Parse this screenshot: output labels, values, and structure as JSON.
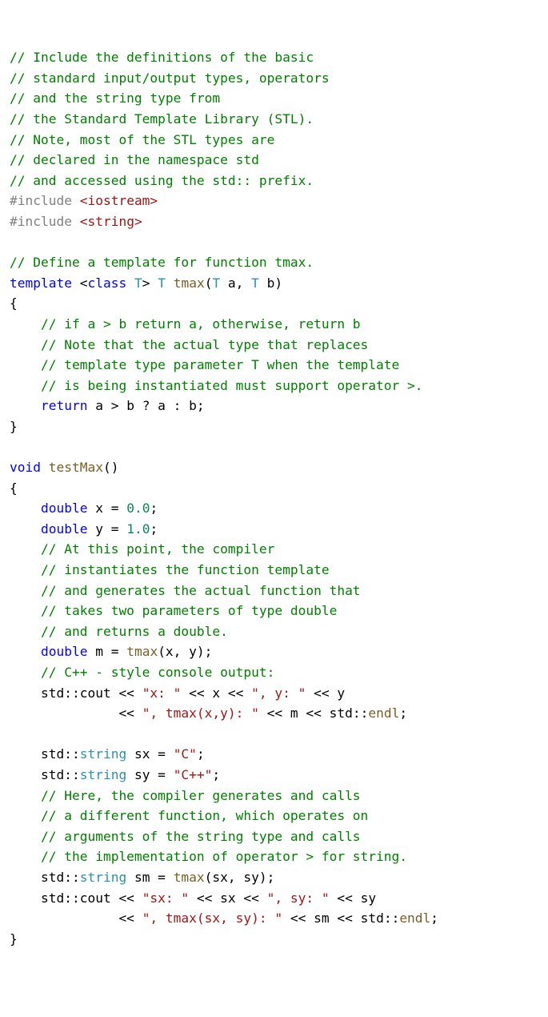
{
  "code": {
    "cm1": "// Include the definitions of the basic",
    "cm2": "// standard input/output types, operators",
    "cm3": "// and the string type from",
    "cm4": "// the Standard Template Library (STL).",
    "cm5": "// Note, most of the STL types are",
    "cm6": "// declared in the namespace std",
    "cm7": "// and accessed using the std:: prefix.",
    "pre_include1": "#include",
    "inc_iostream": "<iostream>",
    "pre_include2": "#include",
    "inc_string": "<string>",
    "cm8": "// Define a template for function tmax.",
    "kw_template": "template",
    "kw_class": "class",
    "tp_T1": "T",
    "tp_T2": "T",
    "fn_tmax_decl": "tmax",
    "tp_T3": "T",
    "tp_T4": "T",
    "cm9": "// if a > b return a, otherwise, return b",
    "cm10": "// Note that the actual type that replaces",
    "cm11": "// template type parameter T when the template",
    "cm12": "// is being instantiated must support operator >.",
    "kw_return1": "return",
    "kw_void": "void",
    "fn_testMax": "testMax",
    "kw_double1": "double",
    "num_0": "0.0",
    "kw_double2": "double",
    "num_1": "1.0",
    "cm13": "// At this point, the compiler",
    "cm14": "// instantiates the function template",
    "cm15": "// and generates the actual function that",
    "cm16": "// takes two parameters of type double",
    "cm17": "// and returns a double.",
    "kw_double3": "double",
    "fn_tmax_call1": "tmax",
    "cm18": "// C++ - style console output:",
    "str_x": "\"x: \"",
    "str_y": "\", y: \"",
    "str_tmaxxy": "\", tmax(x,y): \"",
    "fn_endl1": "endl",
    "ty_string1": "string",
    "str_C": "\"C\"",
    "ty_string2": "string",
    "str_Cpp": "\"C++\"",
    "cm19": "// Here, the compiler generates and calls",
    "cm20": "// a different function, which operates on",
    "cm21": "// arguments of the string type and calls",
    "cm22": "// the implementation of operator > for string.",
    "ty_string3": "string",
    "fn_tmax_call2": "tmax",
    "str_sx": "\"sx: \"",
    "str_sy": "\", sy: \"",
    "str_tmaxsxsy": "\", tmax(sx, sy): \"",
    "fn_endl2": "endl"
  }
}
